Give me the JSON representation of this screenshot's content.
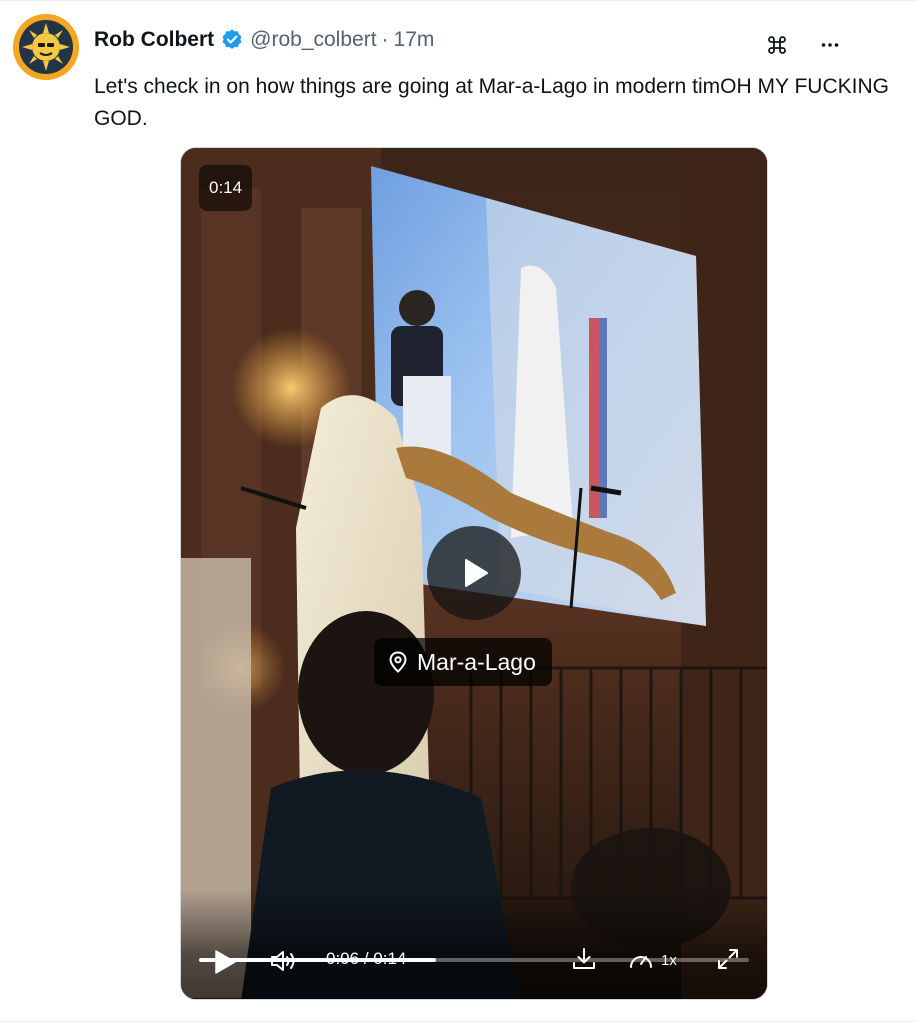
{
  "post": {
    "author_name": "Rob Colbert",
    "handle": "@rob_colbert",
    "separator": "·",
    "timestamp": "17m",
    "text": "Let's check in on how things are going at Mar-a-Lago in modern timOH MY FUCKING GOD.",
    "verified": true,
    "avatar_icon": "sun-face-avatar",
    "actions": {
      "grok_icon": "command-icon",
      "more_label": "···"
    }
  },
  "video": {
    "duration_badge": "0:14",
    "location_label": "Mar-a-Lago",
    "current_time": "0:06",
    "time_separator": " / ",
    "total_time": "0:14",
    "progress_fraction": 0.43,
    "speed_label": "1x"
  },
  "colors": {
    "verified_blue": "#1d9bf0",
    "avatar_orange": "#f5a623",
    "text_primary": "#0f1419",
    "text_secondary": "#536471"
  }
}
